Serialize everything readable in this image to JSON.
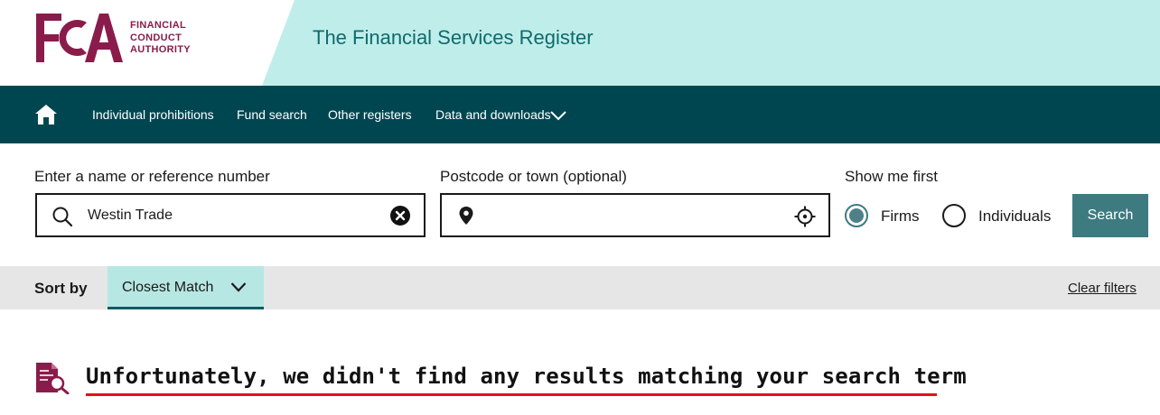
{
  "header": {
    "logo_letters": "FCA",
    "logo_words": [
      "FINANCIAL",
      "CONDUCT",
      "AUTHORITY"
    ],
    "title": "The Financial Services Register"
  },
  "nav": {
    "home_icon": "home-icon",
    "items": [
      {
        "label": "Individual prohibitions"
      },
      {
        "label": "Fund search"
      },
      {
        "label": "Other registers"
      },
      {
        "label": "Data and downloads",
        "has_dropdown": true
      }
    ]
  },
  "search": {
    "name_label": "Enter a name or reference number",
    "name_value": "Westin Trade",
    "postcode_label": "Postcode or town (optional)",
    "postcode_value": "",
    "show_first_label": "Show me first",
    "options": [
      {
        "label": "Firms",
        "checked": true
      },
      {
        "label": "Individuals",
        "checked": false
      }
    ],
    "button_label": "Search"
  },
  "sort": {
    "label": "Sort by",
    "selected": "Closest Match",
    "clear_filters": "Clear filters"
  },
  "message": {
    "text": "Unfortunately, we didn't find any results matching your search term"
  },
  "colors": {
    "brand": "#8a1c4b",
    "nav_bg": "#004651",
    "header_band": "#bfeeea",
    "button": "#3d7b80",
    "sort_select": "#b7e7e2",
    "underline": "#e3101d"
  }
}
